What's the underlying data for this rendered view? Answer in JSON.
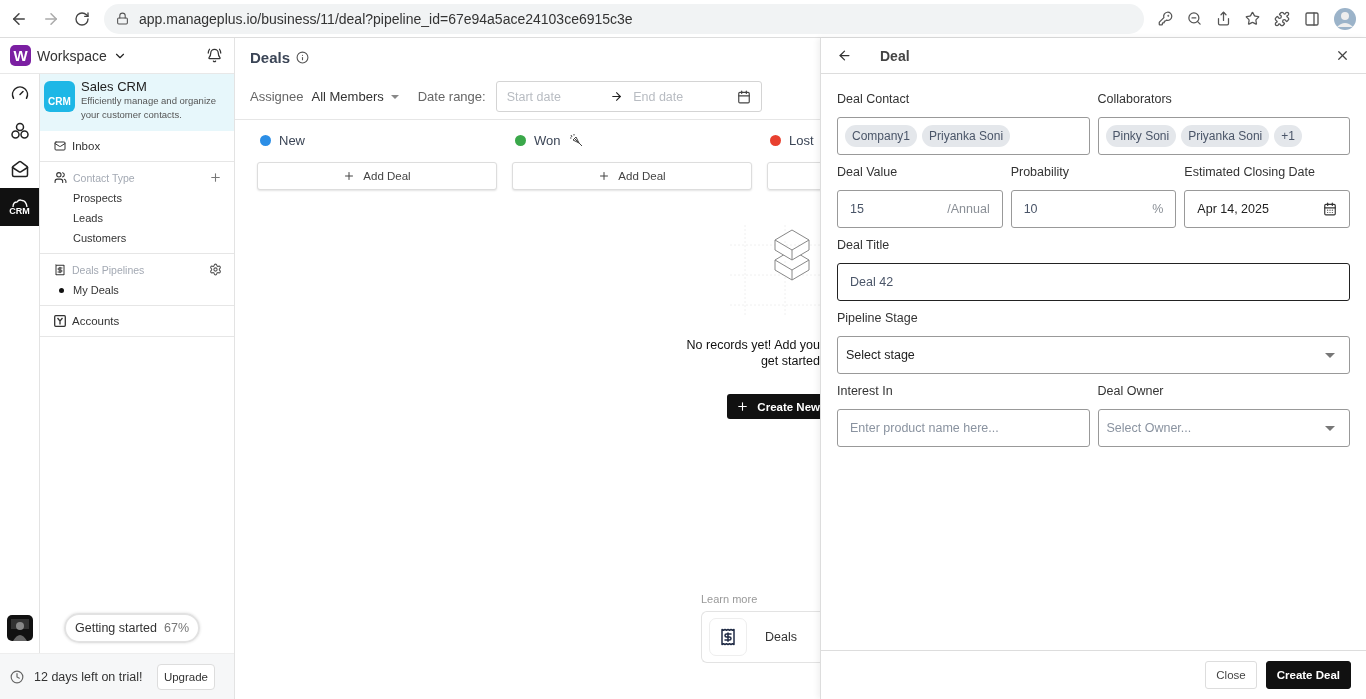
{
  "browser": {
    "url": "app.manageplus.io/business/11/deal?pipeline_id=67e94a5ace24103ce6915c3e"
  },
  "workspace": {
    "logo": "W",
    "name": "Workspace"
  },
  "rail": [
    {
      "kind": "dashboard",
      "selected": false
    },
    {
      "kind": "network",
      "selected": false
    },
    {
      "kind": "campaign",
      "selected": false
    },
    {
      "kind": "crm",
      "label": "CRM",
      "selected": true
    }
  ],
  "app_card": {
    "logo": "CRM",
    "title": "Sales CRM",
    "subtitle": "Efficiently manage and organize your customer contacts."
  },
  "sidebar": [
    {
      "kind": "link",
      "label": "Inbox"
    },
    {
      "kind": "group",
      "label": "Contact Type",
      "children": [
        {
          "label": "Prospects"
        },
        {
          "label": "Leads"
        },
        {
          "label": "Customers"
        }
      ]
    },
    {
      "kind": "pipelines",
      "label": "Deals Pipelines",
      "children": [
        {
          "label": "My Deals"
        }
      ]
    },
    {
      "kind": "link",
      "label": "Accounts"
    }
  ],
  "getting_started": {
    "label": "Getting started",
    "percent": "67%"
  },
  "trial": {
    "text": "12 days left on trial!",
    "button": "Upgrade"
  },
  "page": {
    "title": "Deals",
    "assignee_label": "Assignee",
    "assignee_value": "All Members",
    "date_label": "Date range:",
    "start_placeholder": "Start date",
    "end_placeholder": "End date"
  },
  "stages": [
    {
      "name": "New",
      "color": "#2b8ee6",
      "button": "Add Deal"
    },
    {
      "name": "Won",
      "color": "#3aa84a",
      "button": "Add Deal"
    },
    {
      "name": "Lost",
      "color": "#e8402f"
    }
  ],
  "empty_state": {
    "lines": [
      "No records yet! Add you",
      "get started"
    ],
    "button": "Create New"
  },
  "learn_more": {
    "label": "Learn more",
    "card": "Deals"
  },
  "panel": {
    "title": "Deal",
    "rows": [
      [
        {
          "kind": "chips",
          "label": "Deal Contact",
          "chips": [
            "Company1",
            "Priyanka Soni"
          ]
        },
        {
          "kind": "chips",
          "label": "Collaborators",
          "chips": [
            "Pinky Soni",
            "Priyanka Soni",
            "+1"
          ]
        }
      ],
      [
        {
          "kind": "input",
          "label": "Deal Value",
          "value": "15",
          "suffix": "/Annual"
        },
        {
          "kind": "input",
          "label": "Probability",
          "value": "10",
          "suffix": "%"
        },
        {
          "kind": "date",
          "label": "Estimated Closing Date",
          "value": "Apr 14, 2025"
        }
      ],
      [
        {
          "kind": "input",
          "label": "Deal Title",
          "value": "Deal 42",
          "focused": true
        }
      ],
      [
        {
          "kind": "select",
          "label": "Pipeline Stage",
          "value": "Select stage"
        }
      ],
      [
        {
          "kind": "input",
          "label": "Interest In",
          "placeholder": "Enter product name here..."
        },
        {
          "kind": "select",
          "label": "Deal Owner",
          "placeholder": "Select Owner..."
        }
      ]
    ],
    "buttons": [
      {
        "label": "Close",
        "kind": "secondary"
      },
      {
        "label": "Create Deal",
        "kind": "primary"
      }
    ]
  }
}
